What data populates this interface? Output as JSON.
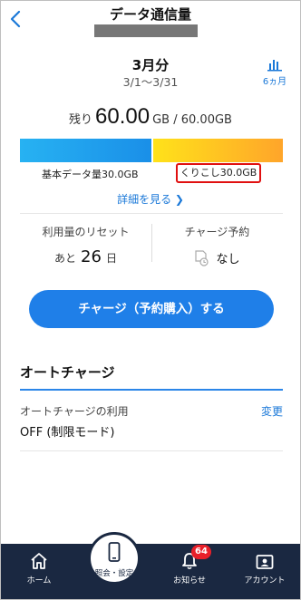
{
  "header": {
    "back_icon": "chevron-left-icon",
    "title": "データ通信量"
  },
  "period": {
    "month": "3月分",
    "range": "3/1〜3/31"
  },
  "history_button": {
    "icon": "bar-chart-icon",
    "label": "6ヵ月"
  },
  "remaining": {
    "label": "残り",
    "value": "60.00",
    "unit": "GB / 60.00GB"
  },
  "usage_bar": {
    "segments": [
      {
        "label": "基本データ量30.0GB",
        "fraction": 0.5,
        "color": "#1a8fe8"
      },
      {
        "label": "くりこし30.0GB",
        "fraction": 0.5,
        "color": "#ffb224"
      }
    ],
    "highlight_color": "#e01010"
  },
  "details_link": "詳細を見る ❯",
  "reset": {
    "title": "利用量のリセット",
    "prefix": "あと",
    "days": "26",
    "suffix": "日"
  },
  "reserve": {
    "title": "チャージ予約",
    "icon": "reservation-icon",
    "value": "なし"
  },
  "charge_button": "チャージ（予約購入）する",
  "auto_charge": {
    "title": "オートチャージ",
    "usage_label": "オートチャージの利用",
    "change_label": "変更",
    "value": "OFF (制限モード)"
  },
  "tabbar": {
    "home": {
      "icon": "home-icon",
      "label": "ホーム"
    },
    "settings": {
      "icon": "smartphone-icon",
      "label": "照会・設定"
    },
    "notifications": {
      "icon": "bell-icon",
      "label": "お知らせ",
      "badge": "64"
    },
    "account": {
      "icon": "id-card-icon",
      "label": "アカウント"
    }
  },
  "colors": {
    "accent": "#1f7fe8",
    "tabbar": "#1a2841",
    "badge": "#e8202a"
  }
}
